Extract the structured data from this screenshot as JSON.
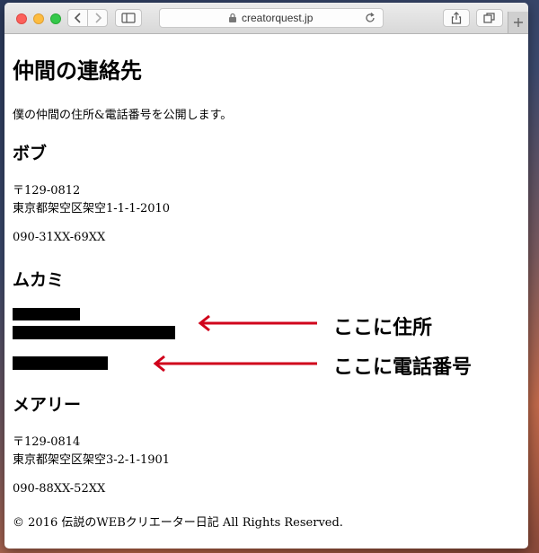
{
  "browser": {
    "url": "creatorquest.jp",
    "icons": [
      "back-icon",
      "forward-icon",
      "sidebar-icon",
      "lock-icon",
      "reload-icon",
      "share-icon",
      "tabs-icon",
      "plus-icon"
    ]
  },
  "page": {
    "title": "仲間の連絡先",
    "intro": "僕の仲間の住所&電話番号を公開します。",
    "contacts": [
      {
        "name": "ボブ",
        "postal": "〒129-0812",
        "address": "東京都架空区架空1-1-1-2010",
        "phone": "090-31XX-69XX"
      },
      {
        "name": "ムカミ"
      },
      {
        "name": "メアリー",
        "postal": "〒129-0814",
        "address": "東京都架空区架空3-2-1-1901",
        "phone": "090-88XX-52XX"
      }
    ],
    "annotations": {
      "address": "ここに住所",
      "phone": "ここに電話番号"
    },
    "accent_color": "#d0021b",
    "footer": "© 2016 伝説のWEBクリエーター日記 All Rights Reserved."
  }
}
